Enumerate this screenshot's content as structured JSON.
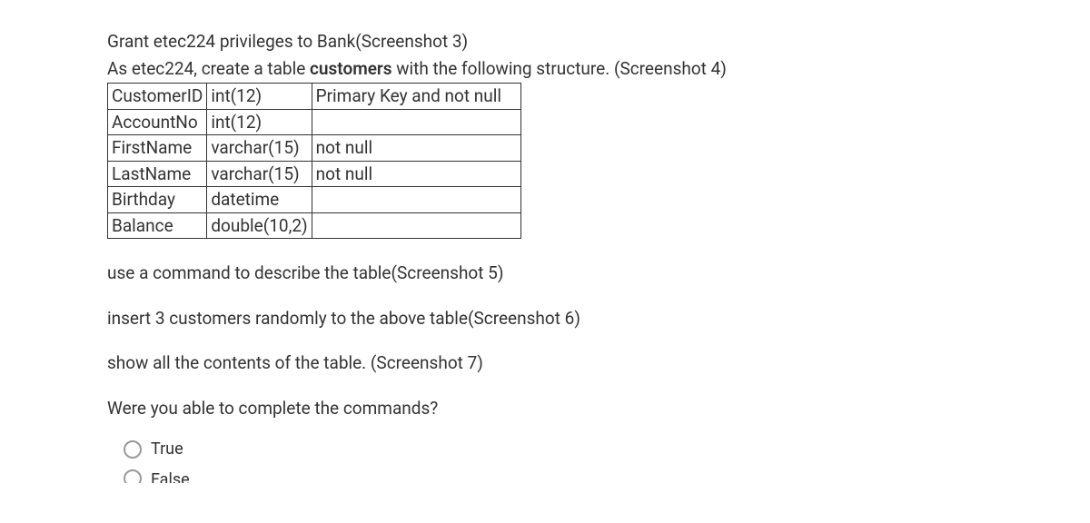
{
  "intro": {
    "line1": "Grant etec224 privileges to Bank(Screenshot 3)",
    "line2_a": "As etec224, create a table ",
    "line2_bold": "customers",
    "line2_b": " with the following structure. (Screenshot 4)"
  },
  "table": {
    "rows": [
      {
        "field": "CustomerID",
        "type": "int(12)",
        "constraint": "Primary Key and not null"
      },
      {
        "field": "AccountNo",
        "type": "int(12)",
        "constraint": ""
      },
      {
        "field": "FirstName",
        "type": "varchar(15)",
        "constraint": "not null"
      },
      {
        "field": "LastName",
        "type": "varchar(15)",
        "constraint": "not null"
      },
      {
        "field": "Birthday",
        "type": "datetime",
        "constraint": ""
      },
      {
        "field": "Balance",
        "type": "double(10,2)",
        "constraint": ""
      }
    ]
  },
  "instructions": {
    "i1": "use a command to describe the table(Screenshot 5)",
    "i2": "insert 3 customers randomly to the above table(Screenshot 6)",
    "i3": "show all the contents of the table. (Screenshot 7)"
  },
  "question": "Were you able to complete the commands?",
  "options": {
    "true": "True",
    "false": "False"
  }
}
